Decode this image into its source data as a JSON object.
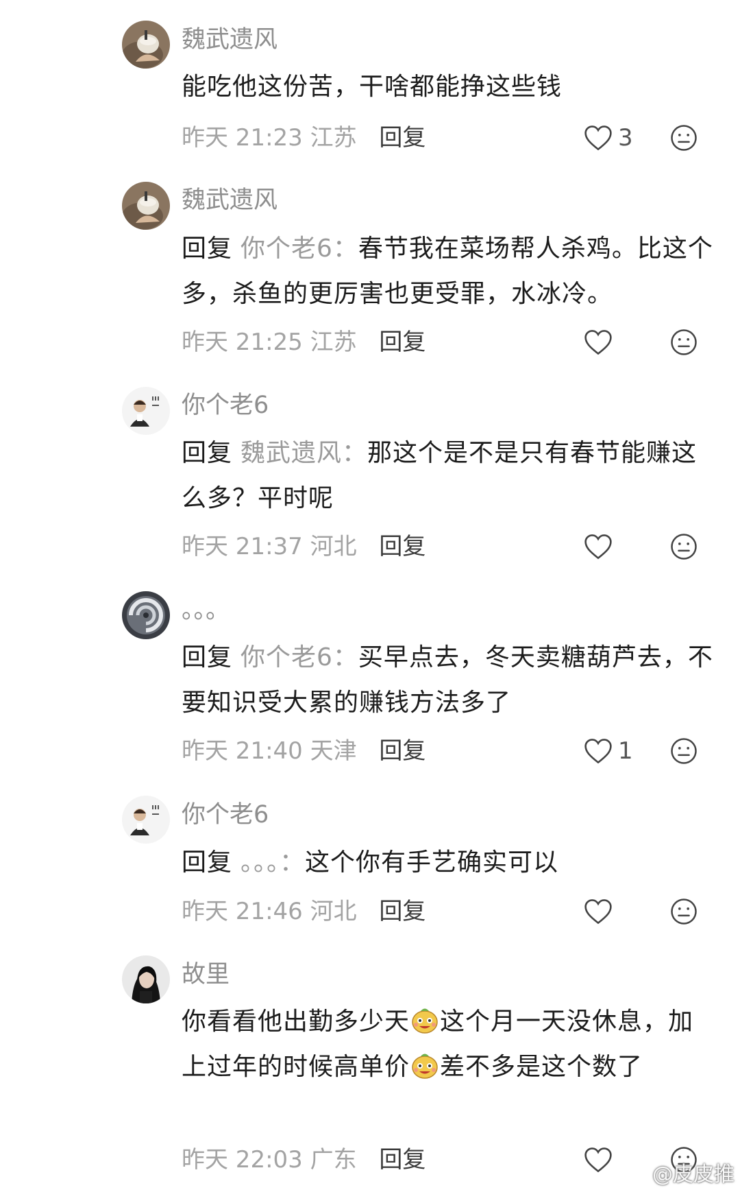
{
  "comments": [
    {
      "author": "魏武遗风",
      "text": "能吃他这份苦，干啥都能挣这些钱",
      "time": "昨天 21:23",
      "location": "江苏",
      "reply_label": "回复",
      "likes": "3"
    },
    {
      "author": "魏武遗风",
      "reply_prefix": "回复",
      "reply_to": "你个老6：",
      "text": "春节我在菜场帮人杀鸡。比这个多，杀鱼的更厉害也更受罪，水冰冷。",
      "time": "昨天 21:25",
      "location": "江苏",
      "reply_label": "回复"
    },
    {
      "author": "你个老6",
      "reply_prefix": "回复",
      "reply_to": "魏武遗风：",
      "text": "那这个是不是只有春节能赚这么多？平时呢",
      "time": "昨天 21:37",
      "location": "河北",
      "reply_label": "回复"
    },
    {
      "author": "。。。",
      "reply_prefix": "回复",
      "reply_to": "你个老6：",
      "text": "买早点去，冬天卖糖葫芦去，不要知识受大累的赚钱方法多了",
      "time": "昨天 21:40",
      "location": "天津",
      "reply_label": "回复",
      "likes": "1"
    },
    {
      "author": "你个老6",
      "reply_prefix": "回复",
      "reply_to": "。。。：",
      "text": "这个你有手艺确实可以",
      "time": "昨天 21:46",
      "location": "河北",
      "reply_label": "回复"
    },
    {
      "author": "故里",
      "text_parts": [
        "你看看他出勤多少天",
        "这个月一天没休息，加上过年的时候高单价",
        "差不多是这个数了"
      ],
      "time": "昨天 22:03",
      "location": "广东",
      "reply_label": "回复"
    }
  ],
  "watermark": "@皮皮推",
  "icons": {
    "like": "heart-outline-icon",
    "dislike": "meh-face-icon",
    "emoji": "grinning-bean-emoji"
  },
  "colors": {
    "author": "#8e8e8e",
    "body": "#1c1c1c",
    "meta": "#a3a3a3",
    "reply_target": "#9a9a9a"
  }
}
